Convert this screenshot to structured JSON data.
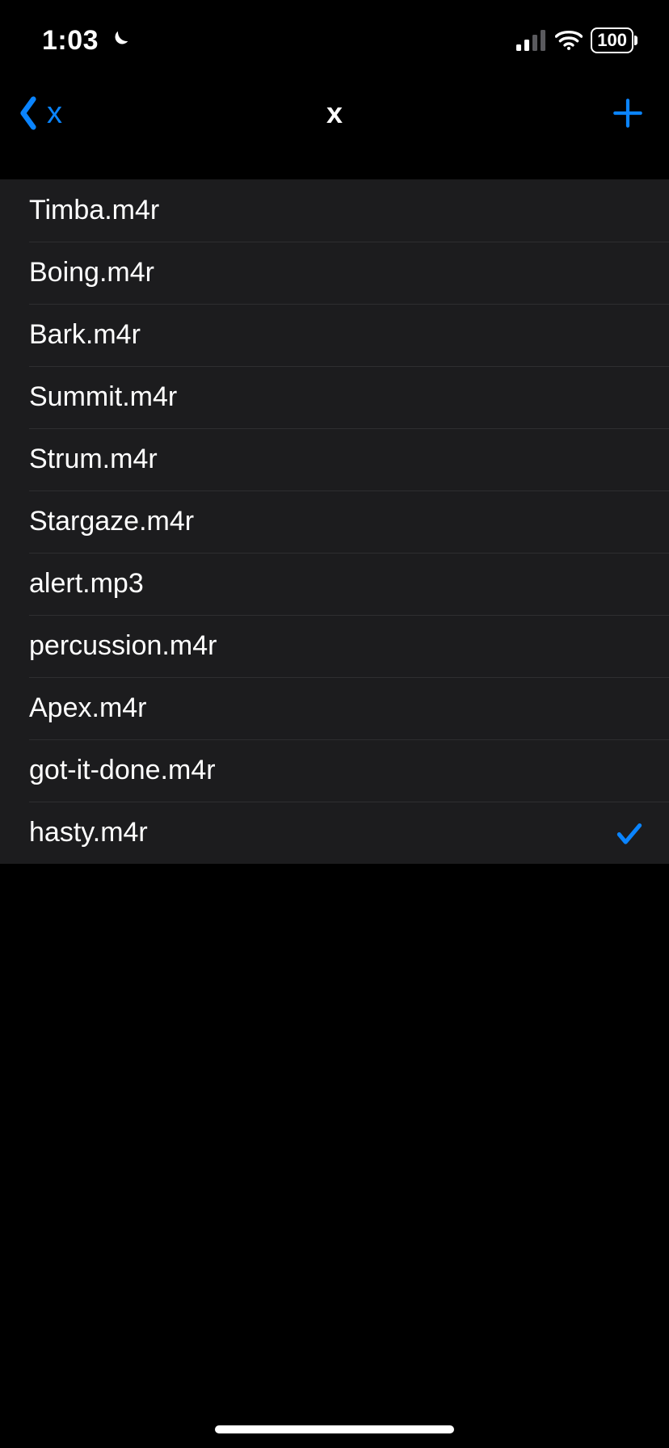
{
  "status": {
    "time": "1:03",
    "dnd": true,
    "battery_text": "100"
  },
  "nav": {
    "back_label": "x",
    "title": "x"
  },
  "list": {
    "items": [
      {
        "label": "Timba.m4r",
        "selected": false
      },
      {
        "label": "Boing.m4r",
        "selected": false
      },
      {
        "label": "Bark.m4r",
        "selected": false
      },
      {
        "label": "Summit.m4r",
        "selected": false
      },
      {
        "label": "Strum.m4r",
        "selected": false
      },
      {
        "label": "Stargaze.m4r",
        "selected": false
      },
      {
        "label": "alert.mp3",
        "selected": false
      },
      {
        "label": "percussion.m4r",
        "selected": false
      },
      {
        "label": "Apex.m4r",
        "selected": false
      },
      {
        "label": "got-it-done.m4r",
        "selected": false
      },
      {
        "label": "hasty.m4r",
        "selected": true
      }
    ]
  }
}
